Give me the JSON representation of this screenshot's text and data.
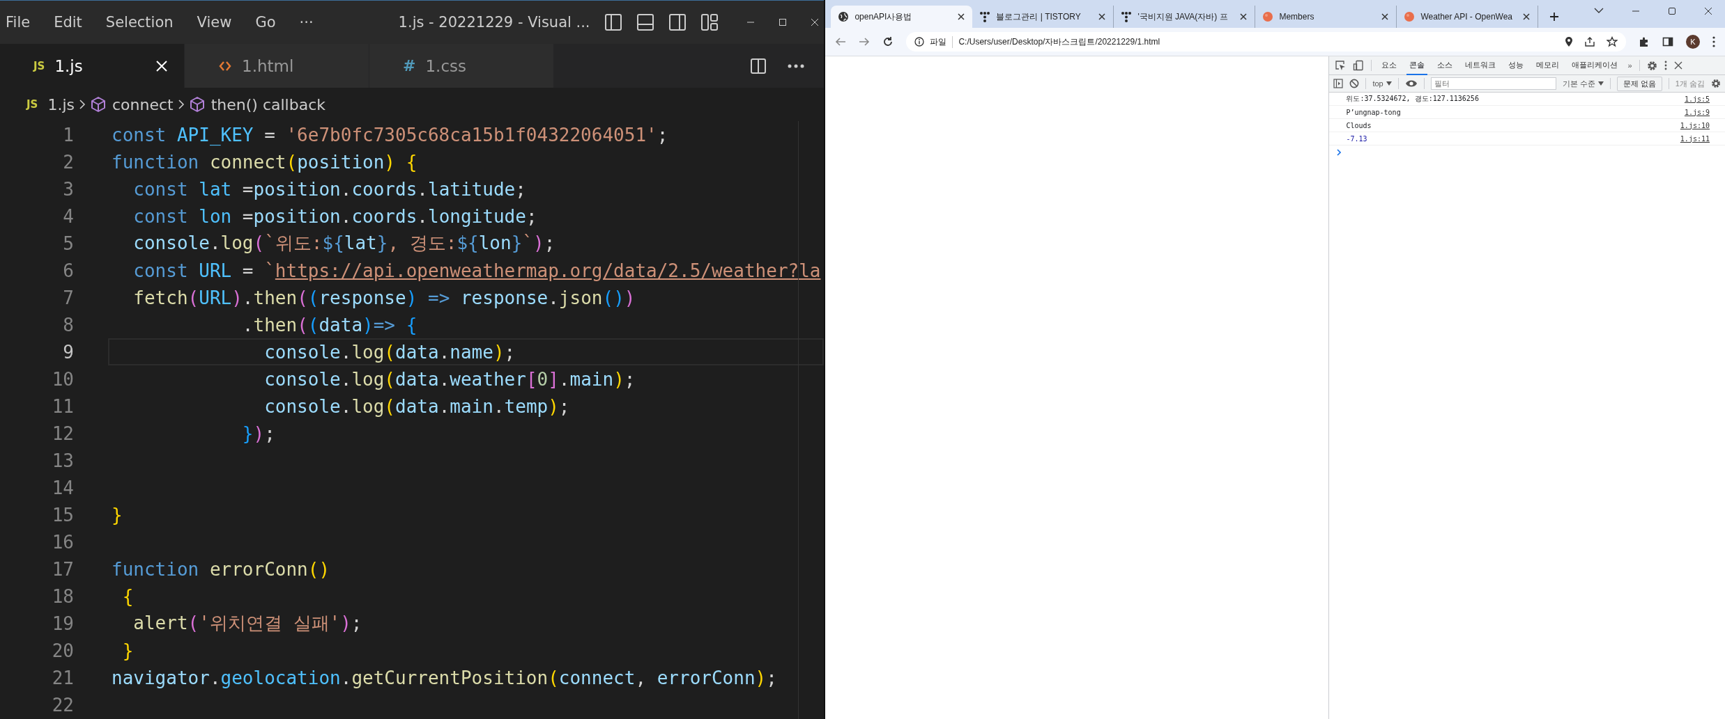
{
  "vscode": {
    "menu": [
      "File",
      "Edit",
      "Selection",
      "View",
      "Go",
      "···"
    ],
    "title": "1.js - 20221229 - Visual ...",
    "tabs": [
      {
        "kind": "js",
        "icon": "JS",
        "label": "1.js",
        "selected": true
      },
      {
        "kind": "html",
        "label": "1.html",
        "selected": false
      },
      {
        "kind": "css",
        "icon": "#",
        "label": "1.css",
        "selected": false
      }
    ],
    "breadcrumb": [
      {
        "kind": "file",
        "icon": "JS",
        "label": "1.js"
      },
      {
        "kind": "symbol",
        "label": "connect"
      },
      {
        "kind": "symbol",
        "label": "then() callback"
      }
    ],
    "lines": [
      {
        "number": "1",
        "current": false,
        "tokens": [
          {
            "kind": "keyword",
            "text": "const "
          },
          {
            "kind": "constant",
            "text": "API_KEY"
          },
          {
            "kind": "plain",
            "text": " = "
          },
          {
            "kind": "string",
            "text": "'6e7b0fc7305c68ca15b1f04322064051'"
          },
          {
            "kind": "plain",
            "text": ";"
          }
        ]
      },
      {
        "number": "2",
        "current": false,
        "tokens": [
          {
            "kind": "keyword",
            "text": "function "
          },
          {
            "kind": "function",
            "text": "connect"
          },
          {
            "kind": "bracket1",
            "text": "("
          },
          {
            "kind": "variable",
            "text": "position"
          },
          {
            "kind": "bracket1",
            "text": ")"
          },
          {
            "kind": "bracket1",
            "text": " {"
          }
        ]
      },
      {
        "number": "3",
        "current": false,
        "tokens": [
          {
            "kind": "keyword",
            "text": "  const "
          },
          {
            "kind": "constant",
            "text": "lat"
          },
          {
            "kind": "plain",
            "text": " ="
          },
          {
            "kind": "variable",
            "text": "position"
          },
          {
            "kind": "plain",
            "text": "."
          },
          {
            "kind": "variable",
            "text": "coords"
          },
          {
            "kind": "plain",
            "text": "."
          },
          {
            "kind": "variable",
            "text": "latitude"
          },
          {
            "kind": "plain",
            "text": ";"
          }
        ]
      },
      {
        "number": "4",
        "current": false,
        "tokens": [
          {
            "kind": "keyword",
            "text": "  const "
          },
          {
            "kind": "constant",
            "text": "lon"
          },
          {
            "kind": "plain",
            "text": " ="
          },
          {
            "kind": "variable",
            "text": "position"
          },
          {
            "kind": "plain",
            "text": "."
          },
          {
            "kind": "variable",
            "text": "coords"
          },
          {
            "kind": "plain",
            "text": "."
          },
          {
            "kind": "variable",
            "text": "longitude"
          },
          {
            "kind": "plain",
            "text": ";"
          }
        ]
      },
      {
        "number": "5",
        "current": false,
        "tokens": [
          {
            "kind": "variable",
            "text": "  console"
          },
          {
            "kind": "plain",
            "text": "."
          },
          {
            "kind": "function",
            "text": "log"
          },
          {
            "kind": "bracket2",
            "text": "("
          },
          {
            "kind": "string",
            "text": "`위도:"
          },
          {
            "kind": "template",
            "text": "${"
          },
          {
            "kind": "variable",
            "text": "lat"
          },
          {
            "kind": "template",
            "text": "}"
          },
          {
            "kind": "string",
            "text": ", 경도:"
          },
          {
            "kind": "template",
            "text": "${"
          },
          {
            "kind": "variable",
            "text": "lon"
          },
          {
            "kind": "template",
            "text": "}"
          },
          {
            "kind": "string",
            "text": "`"
          },
          {
            "kind": "bracket2",
            "text": ")"
          },
          {
            "kind": "plain",
            "text": ";"
          }
        ]
      },
      {
        "number": "6",
        "current": false,
        "tokens": [
          {
            "kind": "keyword",
            "text": "  const "
          },
          {
            "kind": "constant",
            "text": "URL"
          },
          {
            "kind": "plain",
            "text": " = "
          },
          {
            "kind": "string",
            "text": "`"
          },
          {
            "kind": "link",
            "text": "https://api.openweathermap.org/data/2.5/weather?la"
          }
        ]
      },
      {
        "number": "7",
        "current": false,
        "tokens": [
          {
            "kind": "function",
            "text": "  fetch"
          },
          {
            "kind": "bracket2",
            "text": "("
          },
          {
            "kind": "constant",
            "text": "URL"
          },
          {
            "kind": "bracket2",
            "text": ")"
          },
          {
            "kind": "plain",
            "text": "."
          },
          {
            "kind": "function",
            "text": "then"
          },
          {
            "kind": "bracket2",
            "text": "("
          },
          {
            "kind": "bracket3",
            "text": "("
          },
          {
            "kind": "variable",
            "text": "response"
          },
          {
            "kind": "bracket3",
            "text": ")"
          },
          {
            "kind": "keyword",
            "text": " => "
          },
          {
            "kind": "variable",
            "text": "response"
          },
          {
            "kind": "plain",
            "text": "."
          },
          {
            "kind": "function",
            "text": "json"
          },
          {
            "kind": "bracket3",
            "text": "()"
          },
          {
            "kind": "bracket2",
            "text": ")"
          }
        ]
      },
      {
        "number": "8",
        "current": false,
        "tokens": [
          {
            "kind": "plain",
            "text": "            ."
          },
          {
            "kind": "function",
            "text": "then"
          },
          {
            "kind": "bracket2",
            "text": "("
          },
          {
            "kind": "bracket3",
            "text": "("
          },
          {
            "kind": "variable",
            "text": "data"
          },
          {
            "kind": "bracket3",
            "text": ")"
          },
          {
            "kind": "keyword",
            "text": "=> "
          },
          {
            "kind": "bracket3",
            "text": "{"
          }
        ]
      },
      {
        "number": "9",
        "current": true,
        "tokens": [
          {
            "kind": "variable",
            "text": "              console"
          },
          {
            "kind": "plain",
            "text": "."
          },
          {
            "kind": "function",
            "text": "log"
          },
          {
            "kind": "bracket1",
            "text": "("
          },
          {
            "kind": "variable",
            "text": "data"
          },
          {
            "kind": "plain",
            "text": "."
          },
          {
            "kind": "variable",
            "text": "name"
          },
          {
            "kind": "bracket1",
            "text": ")"
          },
          {
            "kind": "plain",
            "text": ";"
          }
        ]
      },
      {
        "number": "10",
        "current": false,
        "tokens": [
          {
            "kind": "variable",
            "text": "              console"
          },
          {
            "kind": "plain",
            "text": "."
          },
          {
            "kind": "function",
            "text": "log"
          },
          {
            "kind": "bracket1",
            "text": "("
          },
          {
            "kind": "variable",
            "text": "data"
          },
          {
            "kind": "plain",
            "text": "."
          },
          {
            "kind": "variable",
            "text": "weather"
          },
          {
            "kind": "bracket2",
            "text": "["
          },
          {
            "kind": "number",
            "text": "0"
          },
          {
            "kind": "bracket2",
            "text": "]"
          },
          {
            "kind": "plain",
            "text": "."
          },
          {
            "kind": "variable",
            "text": "main"
          },
          {
            "kind": "bracket1",
            "text": ")"
          },
          {
            "kind": "plain",
            "text": ";"
          }
        ]
      },
      {
        "number": "11",
        "current": false,
        "tokens": [
          {
            "kind": "variable",
            "text": "              console"
          },
          {
            "kind": "plain",
            "text": "."
          },
          {
            "kind": "function",
            "text": "log"
          },
          {
            "kind": "bracket1",
            "text": "("
          },
          {
            "kind": "variable",
            "text": "data"
          },
          {
            "kind": "plain",
            "text": "."
          },
          {
            "kind": "variable",
            "text": "main"
          },
          {
            "kind": "plain",
            "text": "."
          },
          {
            "kind": "variable",
            "text": "temp"
          },
          {
            "kind": "bracket1",
            "text": ")"
          },
          {
            "kind": "plain",
            "text": ";"
          }
        ]
      },
      {
        "number": "12",
        "current": false,
        "tokens": [
          {
            "kind": "bracket3",
            "text": "            }"
          },
          {
            "kind": "bracket2",
            "text": ")"
          },
          {
            "kind": "plain",
            "text": ";"
          }
        ]
      },
      {
        "number": "13",
        "current": false
      },
      {
        "number": "14",
        "current": false
      },
      {
        "number": "15",
        "current": false,
        "tokens": [
          {
            "kind": "bracket1",
            "text": "}"
          }
        ]
      },
      {
        "number": "16",
        "current": false
      },
      {
        "number": "17",
        "current": false,
        "tokens": [
          {
            "kind": "keyword",
            "text": "function "
          },
          {
            "kind": "function",
            "text": "errorConn"
          },
          {
            "kind": "bracket1",
            "text": "()"
          }
        ]
      },
      {
        "number": "18",
        "current": false,
        "tokens": [
          {
            "kind": "bracket1",
            "text": " {"
          }
        ]
      },
      {
        "number": "19",
        "current": false,
        "tokens": [
          {
            "kind": "function",
            "text": "  alert"
          },
          {
            "kind": "bracket2",
            "text": "("
          },
          {
            "kind": "string",
            "text": "'위치연결 실패'"
          },
          {
            "kind": "bracket2",
            "text": ")"
          },
          {
            "kind": "plain",
            "text": ";"
          }
        ]
      },
      {
        "number": "20",
        "current": false,
        "tokens": [
          {
            "kind": "bracket1",
            "text": " }"
          }
        ]
      },
      {
        "number": "21",
        "current": false,
        "tokens": [
          {
            "kind": "variable",
            "text": "navigator"
          },
          {
            "kind": "plain",
            "text": "."
          },
          {
            "kind": "constant",
            "text": "geolocation"
          },
          {
            "kind": "plain",
            "text": "."
          },
          {
            "kind": "function",
            "text": "getCurrentPosition"
          },
          {
            "kind": "bracket1",
            "text": "("
          },
          {
            "kind": "variable",
            "text": "connect"
          },
          {
            "kind": "plain",
            "text": ", "
          },
          {
            "kind": "variable",
            "text": "errorConn"
          },
          {
            "kind": "bracket1",
            "text": ")"
          },
          {
            "kind": "plain",
            "text": ";"
          }
        ]
      },
      {
        "number": "22",
        "current": false
      }
    ]
  },
  "browser": {
    "tabs": [
      {
        "kind": "globe",
        "title": "openAPI사용법",
        "selected": true
      },
      {
        "kind": "tistory",
        "title": "블로그관리 | TISTORY",
        "selected": false
      },
      {
        "kind": "tistory",
        "title": "'국비지원 JAVA(자바) 프",
        "selected": false
      },
      {
        "kind": "orange",
        "title": "Members",
        "selected": false
      },
      {
        "kind": "orange",
        "title": "Weather API - OpenWea",
        "selected": false
      }
    ],
    "address": {
      "scheme": "파일",
      "url": "C:/Users/user/Desktop/자바스크립트/20221229/1.html"
    },
    "profile": "K",
    "devtools": {
      "tabs": [
        {
          "label": "요소",
          "selected": false
        },
        {
          "label": "콘솔",
          "selected": true
        },
        {
          "label": "소스",
          "selected": false
        },
        {
          "label": "네트워크",
          "selected": false
        },
        {
          "label": "성능",
          "selected": false
        },
        {
          "label": "메모리",
          "selected": false
        },
        {
          "label": "애플리케이션",
          "selected": false
        }
      ],
      "more": "»",
      "context": "top",
      "filter_placeholder": "필터",
      "level": "기본 수준",
      "issues": "문제 없음",
      "hidden": "1개 숨김",
      "messages": [
        {
          "kind": "text",
          "text": "위도:37.5324672, 경도:127.1136256",
          "source": "1.js:5"
        },
        {
          "kind": "text",
          "text": "P’ungnap-tong",
          "source": "1.js:9"
        },
        {
          "kind": "text",
          "text": "Clouds",
          "source": "1.js:10"
        },
        {
          "kind": "number",
          "text": "-7.13",
          "source": "1.js:11"
        }
      ]
    }
  }
}
